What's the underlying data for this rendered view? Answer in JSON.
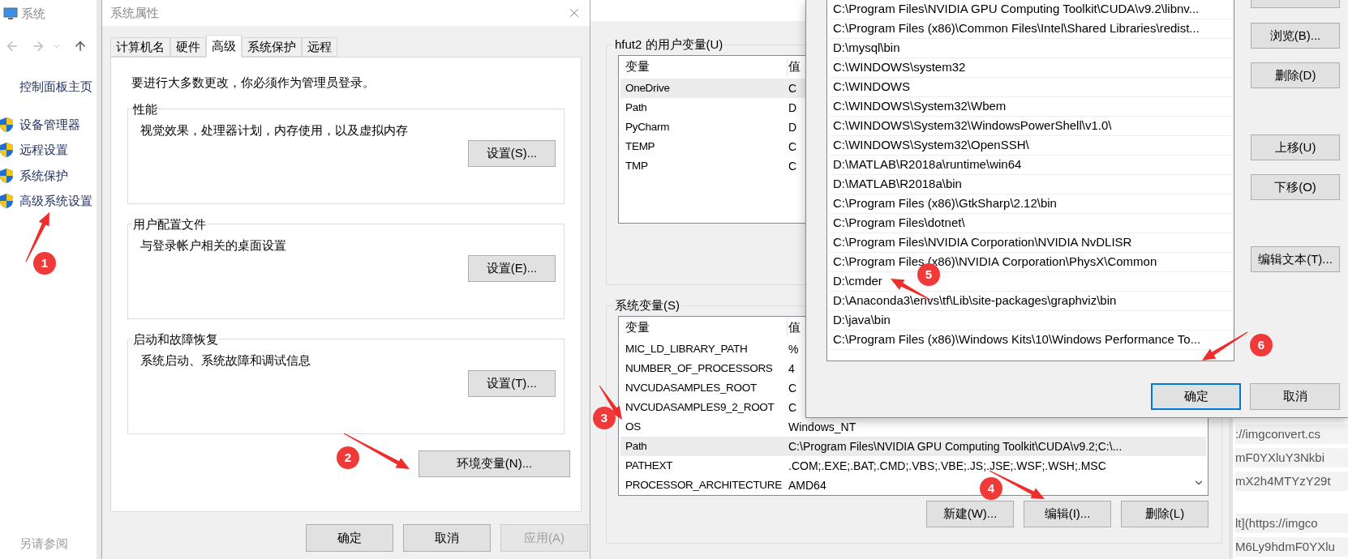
{
  "explorer": {
    "title": "系统",
    "home_link": "控制面板主页",
    "tasks": [
      "设备管理器",
      "远程设置",
      "系统保护",
      "高级系统设置"
    ],
    "see_also": "另请参阅"
  },
  "system_properties": {
    "title": "系统属性",
    "tabs": [
      {
        "label": "计算机名",
        "selected": false
      },
      {
        "label": "硬件",
        "selected": false
      },
      {
        "label": "高级",
        "selected": true
      },
      {
        "label": "系统保护",
        "selected": false
      },
      {
        "label": "远程",
        "selected": false
      }
    ],
    "admin_note": "要进行大多数更改，你必须作为管理员登录。",
    "groups": [
      {
        "title": "性能",
        "description": "视觉效果，处理器计划，内存使用，以及虚拟内存",
        "button": "设置(S)..."
      },
      {
        "title": "用户配置文件",
        "description": "与登录帐户相关的桌面设置",
        "button": "设置(E)..."
      },
      {
        "title": "启动和故障恢复",
        "description": "系统启动、系统故障和调试信息",
        "button": "设置(T)..."
      }
    ],
    "env_button": "环境变量(N)...",
    "buttons": [
      {
        "label": "确定",
        "disabled": false
      },
      {
        "label": "取消",
        "disabled": false
      },
      {
        "label": "应用(A)",
        "disabled": true
      }
    ]
  },
  "environment_variables": {
    "user_group": {
      "title": "hfut2 的用户变量(U)",
      "columns": [
        "变量",
        "值"
      ],
      "rows": [
        {
          "name": "OneDrive",
          "value": "C",
          "selected": true
        },
        {
          "name": "Path",
          "value": "D",
          "selected": false
        },
        {
          "name": "PyCharm",
          "value": "D",
          "selected": false
        },
        {
          "name": "TEMP",
          "value": "C",
          "selected": false
        },
        {
          "name": "TMP",
          "value": "C",
          "selected": false
        }
      ]
    },
    "system_group": {
      "title": "系统变量(S)",
      "columns": [
        "变量",
        "值"
      ],
      "rows": [
        {
          "name": "MIC_LD_LIBRARY_PATH",
          "value": "%",
          "selected": false
        },
        {
          "name": "NUMBER_OF_PROCESSORS",
          "value": "4",
          "selected": false
        },
        {
          "name": "NVCUDASAMPLES_ROOT",
          "value": "C",
          "selected": false
        },
        {
          "name": "NVCUDASAMPLES9_2_ROOT",
          "value": "C",
          "selected": false
        },
        {
          "name": "OS",
          "value": "Windows_NT",
          "selected": false
        },
        {
          "name": "Path",
          "value": "C:\\Program Files\\NVIDIA GPU Computing Toolkit\\CUDA\\v9.2;C:\\...",
          "selected": true
        },
        {
          "name": "PATHEXT",
          "value": ".COM;.EXE;.BAT;.CMD;.VBS;.VBE;.JS;.JSE;.WSF;.WSH;.MSC",
          "selected": false
        },
        {
          "name": "PROCESSOR_ARCHITECTURE",
          "value": "AMD64",
          "selected": false
        }
      ]
    },
    "buttons": [
      "新建(W)...",
      "编辑(I)...",
      "删除(L)"
    ]
  },
  "edit_path": {
    "entries": [
      "C:\\Program Files\\NVIDIA GPU Computing Toolkit\\CUDA\\v9.2\\libnv...",
      "C:\\Program Files (x86)\\Common Files\\Intel\\Shared Libraries\\redist...",
      "D:\\mysql\\bin",
      "C:\\WINDOWS\\system32",
      "C:\\WINDOWS",
      "C:\\WINDOWS\\System32\\Wbem",
      "C:\\WINDOWS\\System32\\WindowsPowerShell\\v1.0\\",
      "C:\\WINDOWS\\System32\\OpenSSH\\",
      "D:\\MATLAB\\R2018a\\runtime\\win64",
      "D:\\MATLAB\\R2018a\\bin",
      "C:\\Program Files (x86)\\GtkSharp\\2.12\\bin",
      "C:\\Program Files\\dotnet\\",
      "C:\\Program Files\\NVIDIA Corporation\\NVIDIA NvDLISR",
      "C:\\Program Files (x86)\\NVIDIA Corporation\\PhysX\\Common",
      "D:\\cmder",
      "D:\\Anaconda3\\envs\\tf\\Lib\\site-packages\\graphviz\\bin",
      "D:\\java\\bin",
      "C:\\Program Files (x86)\\Windows Kits\\10\\Windows Performance To..."
    ],
    "side_buttons": [
      "浏览(B)...",
      "删除(D)",
      "上移(U)",
      "下移(O)",
      "编辑文本(T)..."
    ],
    "buttons": [
      {
        "label": "确定",
        "default": true
      },
      {
        "label": "取消",
        "default": false
      }
    ]
  },
  "editor": {
    "paragraphs": [
      [
        "://imgconvert.cs",
        "mF0YXluY3Nkbi",
        "mX2h4MTYzY29t"
      ],
      [
        "lt](https://imgco",
        "M6Ly9hdmF0YXlu"
      ]
    ]
  },
  "annotations": [
    {
      "label": "1"
    },
    {
      "label": "2"
    },
    {
      "label": "3"
    },
    {
      "label": "4"
    },
    {
      "label": "5"
    },
    {
      "label": "6"
    }
  ]
}
